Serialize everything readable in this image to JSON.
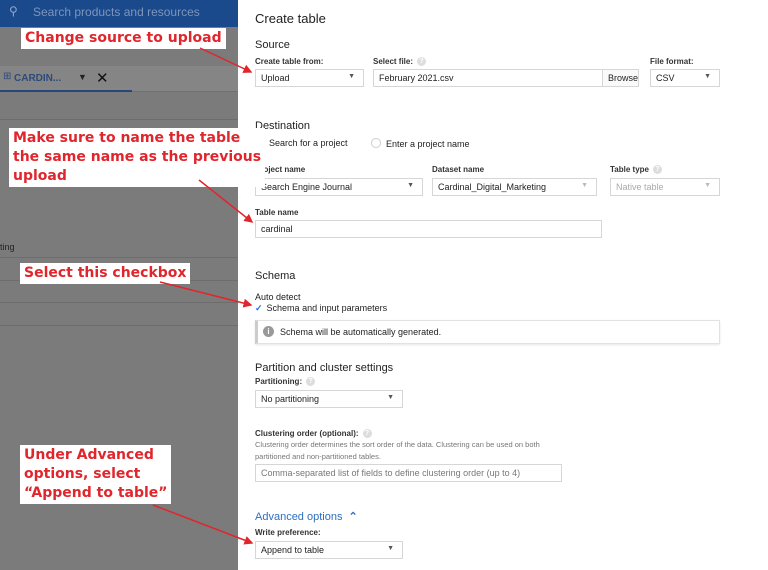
{
  "background": {
    "search_placeholder": "Search products and resources",
    "tab_label": "CARDIN...",
    "row_text": "ting"
  },
  "panel": {
    "title": "Create table",
    "source": {
      "heading": "Source",
      "create_from_label": "Create table from:",
      "create_from_value": "Upload",
      "select_file_label": "Select file:",
      "file_value": "February 2021.csv",
      "browse_label": "Browse",
      "file_format_label": "File format:",
      "file_format_value": "CSV"
    },
    "destination": {
      "heading": "Destination",
      "radio_search": "Search for a project",
      "radio_enter": "Enter a project name",
      "selected_radio": "Search for a project",
      "project_label": "Project name",
      "project_value": "Search Engine Journal",
      "dataset_label": "Dataset name",
      "dataset_value": "Cardinal_Digital_Marketing",
      "table_type_label": "Table type",
      "table_type_value": "Native table",
      "table_name_label": "Table name",
      "table_name_value": "cardinal"
    },
    "schema": {
      "heading": "Schema",
      "auto_detect_label": "Auto detect",
      "checkbox_label": "Schema and input parameters",
      "checked": true,
      "info_text": "Schema will be automatically generated."
    },
    "partition": {
      "heading": "Partition and cluster settings",
      "partitioning_label": "Partitioning:",
      "partitioning_value": "No partitioning",
      "clustering_label": "Clustering order (optional):",
      "clustering_desc_1": "Clustering order determines the sort order of the data. Clustering can be used on both",
      "clustering_desc_2": "partitioned and non-partitioned tables.",
      "clustering_placeholder": "Comma-separated list of fields to define clustering order (up to 4)"
    },
    "advanced": {
      "toggle_label": "Advanced options",
      "write_pref_label": "Write preference:",
      "write_pref_value": "Append to table"
    }
  },
  "annotations": {
    "a1": "Change source to upload",
    "a2_1": "Make sure to name the table",
    "a2_2": "the same name as the previous",
    "a2_3": "upload",
    "a3": "Select this checkbox",
    "a4_1": "Under Advanced",
    "a4_2": "options, select",
    "a4_3": "“Append to table”"
  },
  "colors": {
    "accent": "#1a73e8",
    "annotation": "#e0262d",
    "topbar": "#1a4a8c"
  }
}
